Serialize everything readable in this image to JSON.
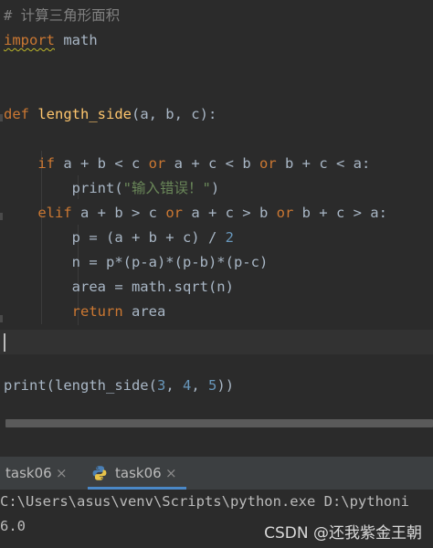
{
  "editor": {
    "lines": [
      {
        "tokens": [
          {
            "t": "# 计算三角形面积",
            "c": "cmt"
          }
        ]
      },
      {
        "tokens": [
          {
            "t": "import",
            "c": "kw squiggle"
          },
          {
            "t": " math",
            "c": "plain"
          }
        ]
      },
      {
        "tokens": []
      },
      {
        "tokens": []
      },
      {
        "tokens": [
          {
            "t": "def ",
            "c": "kw"
          },
          {
            "t": "length_side",
            "c": "fn"
          },
          {
            "t": "(a, b, c):",
            "c": "plain"
          }
        ]
      },
      {
        "tokens": []
      },
      {
        "tokens": [
          {
            "t": "    ",
            "c": "plain"
          },
          {
            "t": "if",
            "c": "kw"
          },
          {
            "t": " a + b < c ",
            "c": "plain"
          },
          {
            "t": "or",
            "c": "kw"
          },
          {
            "t": " a + c < b ",
            "c": "plain"
          },
          {
            "t": "or",
            "c": "kw"
          },
          {
            "t": " b + c < a:",
            "c": "plain"
          }
        ]
      },
      {
        "tokens": [
          {
            "t": "        print(",
            "c": "plain"
          },
          {
            "t": "\"输入错误！\"",
            "c": "str"
          },
          {
            "t": ")",
            "c": "plain"
          }
        ]
      },
      {
        "tokens": [
          {
            "t": "    ",
            "c": "plain"
          },
          {
            "t": "elif",
            "c": "kw"
          },
          {
            "t": " a + b > c ",
            "c": "plain"
          },
          {
            "t": "or",
            "c": "kw"
          },
          {
            "t": " a + c > b ",
            "c": "plain"
          },
          {
            "t": "or",
            "c": "kw"
          },
          {
            "t": " b + c > a:",
            "c": "plain"
          }
        ]
      },
      {
        "tokens": [
          {
            "t": "        p = (a + b + c) / ",
            "c": "plain"
          },
          {
            "t": "2",
            "c": "num"
          }
        ]
      },
      {
        "tokens": [
          {
            "t": "        n = p*(p-a)*(p-b)*(p-c)",
            "c": "plain"
          }
        ]
      },
      {
        "tokens": [
          {
            "t": "        area = math.sqrt(n)",
            "c": "plain"
          }
        ]
      },
      {
        "tokens": [
          {
            "t": "        ",
            "c": "plain"
          },
          {
            "t": "return",
            "c": "kw"
          },
          {
            "t": " area",
            "c": "plain"
          }
        ]
      },
      {
        "tokens": []
      },
      {
        "tokens": []
      },
      {
        "tokens": [
          {
            "t": "print(length_side(",
            "c": "plain"
          },
          {
            "t": "3",
            "c": "num"
          },
          {
            "t": ", ",
            "c": "plain"
          },
          {
            "t": "4",
            "c": "num"
          },
          {
            "t": ", ",
            "c": "plain"
          },
          {
            "t": "5",
            "c": "num"
          },
          {
            "t": "))",
            "c": "plain"
          }
        ]
      }
    ]
  },
  "tabs": [
    {
      "label": "task06",
      "close": "×",
      "active": false
    },
    {
      "label": "task06",
      "close": "×",
      "active": true
    }
  ],
  "console": {
    "lines": [
      "C:\\Users\\asus\\venv\\Scripts\\python.exe D:\\pythoni",
      "6.0"
    ]
  },
  "watermark": "CSDN @还我紫金王朝",
  "colors": {
    "keyword": "#cc7832",
    "number": "#6897bb",
    "string": "#6a8759",
    "function": "#ffc66d",
    "comment": "#808080",
    "text": "#a9b7c6",
    "background": "#2b2b2b",
    "tab_accent": "#4a88c7"
  },
  "icons": {
    "run_tab_icon": "python-icon",
    "tab_close_icon": "close-icon"
  }
}
